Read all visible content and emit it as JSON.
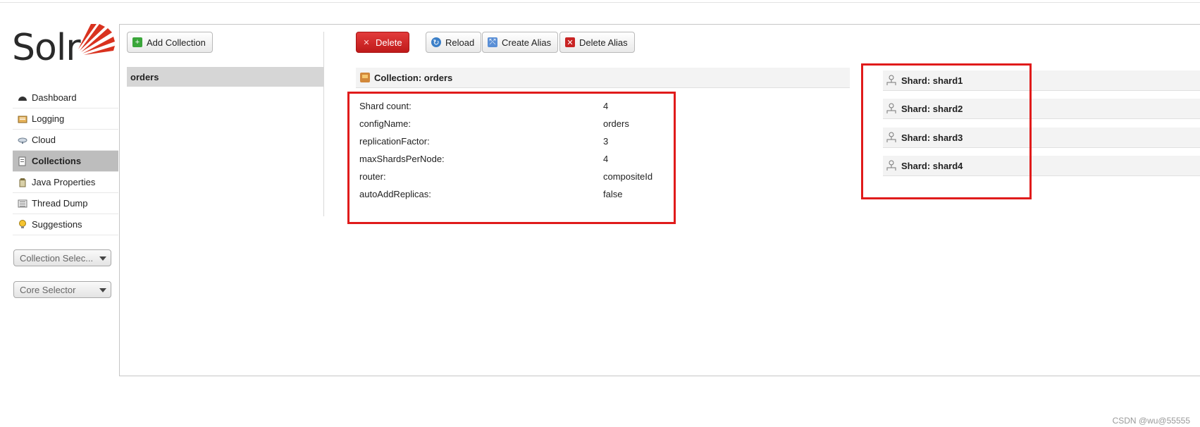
{
  "logo": {
    "text": "Solr"
  },
  "nav": {
    "items": [
      {
        "label": "Dashboard",
        "icon": "dashboard-icon",
        "active": false
      },
      {
        "label": "Logging",
        "icon": "logging-icon",
        "active": false
      },
      {
        "label": "Cloud",
        "icon": "cloud-icon",
        "active": false
      },
      {
        "label": "Collections",
        "icon": "collections-icon",
        "active": true
      },
      {
        "label": "Java Properties",
        "icon": "java-icon",
        "active": false
      },
      {
        "label": "Thread Dump",
        "icon": "thread-dump-icon",
        "active": false
      },
      {
        "label": "Suggestions",
        "icon": "lightbulb-icon",
        "active": false
      }
    ],
    "collection_selector": "Collection Selec...",
    "core_selector": "Core Selector"
  },
  "collections": {
    "add_label": "Add Collection",
    "list": [
      "orders"
    ]
  },
  "toolbar": {
    "delete_label": "Delete",
    "reload_label": "Reload",
    "create_alias_label": "Create Alias",
    "delete_alias_label": "Delete Alias"
  },
  "detail": {
    "header": "Collection: orders",
    "properties": [
      {
        "key": "Shard count:",
        "value": "4"
      },
      {
        "key": "configName:",
        "value": "orders"
      },
      {
        "key": "replicationFactor:",
        "value": "3"
      },
      {
        "key": "maxShardsPerNode:",
        "value": "4"
      },
      {
        "key": "router:",
        "value": "compositeId"
      },
      {
        "key": "autoAddReplicas:",
        "value": "false"
      }
    ]
  },
  "shards": [
    "Shard: shard1",
    "Shard: shard2",
    "Shard: shard3",
    "Shard: shard4"
  ],
  "colors": {
    "accent_red": "#e01b1b",
    "delete_button": "#c92424",
    "active_nav": "#bdbdbd"
  },
  "watermark": "CSDN @wu@55555"
}
